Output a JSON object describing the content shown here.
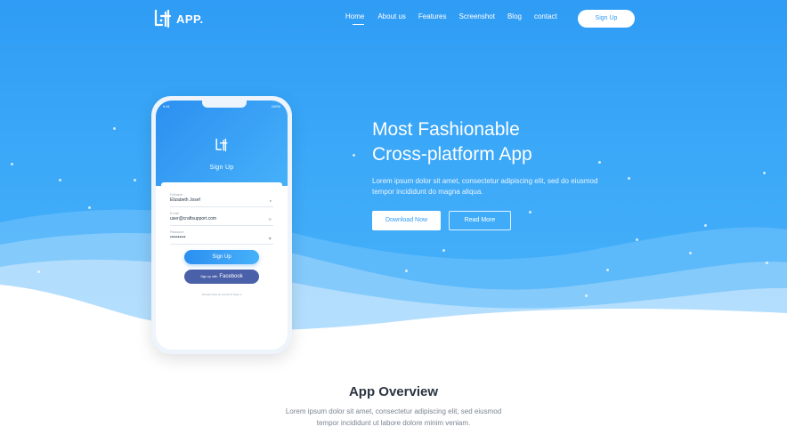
{
  "header": {
    "logo_text": "APP.",
    "nav": [
      "Home",
      "About us",
      "Features",
      "Screenshot",
      "Blog",
      "contact"
    ],
    "active_nav": "Home",
    "signup_label": "Sign Up"
  },
  "hero": {
    "title_line1": "Most Fashionable",
    "title_line2": "Cross-platform App",
    "lead": "Lorem ipsum dolor sit amet, consectetur adipiscing elit, sed do eiusmod tempor incididunt do magna aliqua.",
    "download_label": "Download Now",
    "read_more_label": "Read More"
  },
  "phone": {
    "status_time": "9:41",
    "status_right": "100%",
    "screen_title": "Sign Up",
    "fields": [
      {
        "label": "Fullname",
        "value": "Elizabeth Josef",
        "icon": "user-icon"
      },
      {
        "label": "E-mail",
        "value": "user@craftsupport.com",
        "icon": "mail-icon"
      },
      {
        "label": "Password",
        "value": "••••••••••",
        "icon": "lock-icon"
      }
    ],
    "signup_button": "Sign Up",
    "facebook_prefix": "Sign up with",
    "facebook_button": "Facebook",
    "footer": "Already have an account? Sign in"
  },
  "overview": {
    "title": "App Overview",
    "text_line1": "Lorem ipsum dolor sit amet, consectetur adipiscing elit, sed eiusmod",
    "text_line2": "tempor incididunt ut labore dolore minim veniam."
  },
  "colors": {
    "primary": "#2f9cf5",
    "facebook": "#4a60a8"
  }
}
